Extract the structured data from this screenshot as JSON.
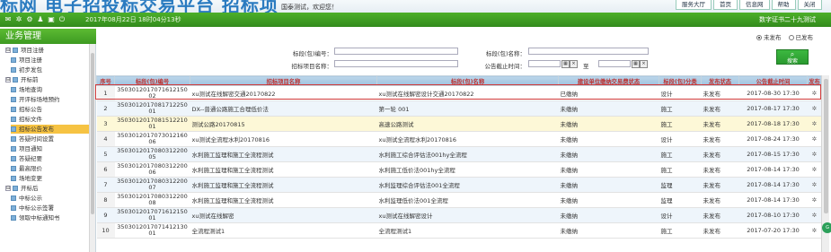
{
  "header": {
    "logo_text": "标网   电子招投标交易平台   招标项",
    "welcome": "国泰测试，欢迎您！",
    "nav": [
      "服务大厅",
      "首页",
      "信息网",
      "帮助",
      "关闭"
    ]
  },
  "statusbar": {
    "datetime": "2017年08月22日 18时04分13秒",
    "cert": "数字证书二十九测试"
  },
  "sidebar": {
    "title": "业务管理",
    "items": [
      {
        "label": "项目注册",
        "level": 0,
        "expander": "⊟"
      },
      {
        "label": "项目注册",
        "level": 1
      },
      {
        "label": "初步发包",
        "level": 1
      },
      {
        "label": "开标前",
        "level": 0,
        "expander": "⊟"
      },
      {
        "label": "场地查询",
        "level": 1
      },
      {
        "label": "开评标场地预约",
        "level": 1
      },
      {
        "label": "招标公告",
        "level": 1
      },
      {
        "label": "招标文件",
        "level": 1
      },
      {
        "label": "招标公告发布",
        "level": 1,
        "selected": true
      },
      {
        "label": "答疑时间设置",
        "level": 1
      },
      {
        "label": "项目通知",
        "level": 1
      },
      {
        "label": "答疑纪要",
        "level": 1
      },
      {
        "label": "最高限价",
        "level": 1
      },
      {
        "label": "场地变更",
        "level": 1
      },
      {
        "label": "开标后",
        "level": 0,
        "expander": "⊟"
      },
      {
        "label": "中标公示",
        "level": 1
      },
      {
        "label": "中标公示签署",
        "level": 1
      },
      {
        "label": "领取中标通知书",
        "level": 1
      }
    ]
  },
  "filters": {
    "radio_unpublished": "未发布",
    "radio_published": "已发布",
    "section_code_label": "标段(包)编号：",
    "section_name_label": "标段(包)名称：",
    "project_name_label": "招标项目名称：",
    "deadline_label": "公告截止时间：",
    "to_label": "至",
    "search_label": "搜索",
    "search_sub": "CLICK SEARCH"
  },
  "table": {
    "headers": [
      "序号",
      "标段(包)编号",
      "招标项目名称",
      "标段(包)名称",
      "建设单位缴纳交易费状态",
      "标段(包)分类",
      "发布状态",
      "公告截止时间",
      "发布"
    ],
    "rows": [
      {
        "no": "1",
        "code": "350301201707161215002",
        "project": "xu测试在线解密交通20170822",
        "section": "xu测试在线解密设计交通20170822",
        "fee": "已缴纳",
        "category": "设计",
        "status": "未发布",
        "deadline": "2017-08-30 17:30",
        "style": "white"
      },
      {
        "no": "2",
        "code": "350301201708171225001",
        "project": "DX--普通公路施工合理低价法",
        "section": "第一轮 001",
        "fee": "未缴纳",
        "category": "施工",
        "status": "未发布",
        "deadline": "2017-08-17 17:30",
        "style": "alt"
      },
      {
        "no": "3",
        "code": "350301201708151221001",
        "project": "测试公路20170815",
        "section": "高速公路测试",
        "fee": "未缴纳",
        "category": "施工",
        "status": "未发布",
        "deadline": "2017-08-18 17:30",
        "style": "yel"
      },
      {
        "no": "4",
        "code": "350301201707301216006",
        "project": "xu测试全流程水利20170816",
        "section": "xu测试全流程水利20170816",
        "fee": "未缴纳",
        "category": "设计",
        "status": "未发布",
        "deadline": "2017-08-24 17:30",
        "style": "white"
      },
      {
        "no": "5",
        "code": "350301201708031220005",
        "project": "水利施工监理和施工全流程测试",
        "section": "水利施工综合评估法001hy全流程",
        "fee": "未缴纳",
        "category": "施工",
        "status": "未发布",
        "deadline": "2017-08-15 17:30",
        "style": "alt"
      },
      {
        "no": "6",
        "code": "350301201708031220006",
        "project": "水利施工监理和施工全流程测试",
        "section": "水利施工低价法001hy全流程",
        "fee": "未缴纳",
        "category": "施工",
        "status": "未发布",
        "deadline": "2017-08-14 17:30",
        "style": "white"
      },
      {
        "no": "7",
        "code": "350301201708031220007",
        "project": "水利施工监理和施工全流程测试",
        "section": "水利监理综合评估法001全流程",
        "fee": "未缴纳",
        "category": "监理",
        "status": "未发布",
        "deadline": "2017-08-14 17:30",
        "style": "alt"
      },
      {
        "no": "8",
        "code": "350301201708031220008",
        "project": "水利施工监理和施工全流程测试",
        "section": "水利监理低价法001全流程",
        "fee": "未缴纳",
        "category": "监理",
        "status": "未发布",
        "deadline": "2017-08-14 17:30",
        "style": "white"
      },
      {
        "no": "9",
        "code": "350301201707161215001",
        "project": "xu测试在线解密",
        "section": "xu测试在线解密设计",
        "fee": "未缴纳",
        "category": "设计",
        "status": "未发布",
        "deadline": "2017-08-10 17:30",
        "style": "alt"
      },
      {
        "no": "10",
        "code": "350301201707141213001",
        "project": "全流程测试1",
        "section": "全流程测试1",
        "fee": "未缴纳",
        "category": "施工",
        "status": "未发布",
        "deadline": "2017-07-20 17:30",
        "style": "white"
      }
    ],
    "publish_icon": "gear-icon"
  },
  "colors": {
    "green_bar": "#3d9a22",
    "header_text": "#b33333",
    "selected_item": "#f6c343",
    "highlight_border": "#d03a3a"
  }
}
